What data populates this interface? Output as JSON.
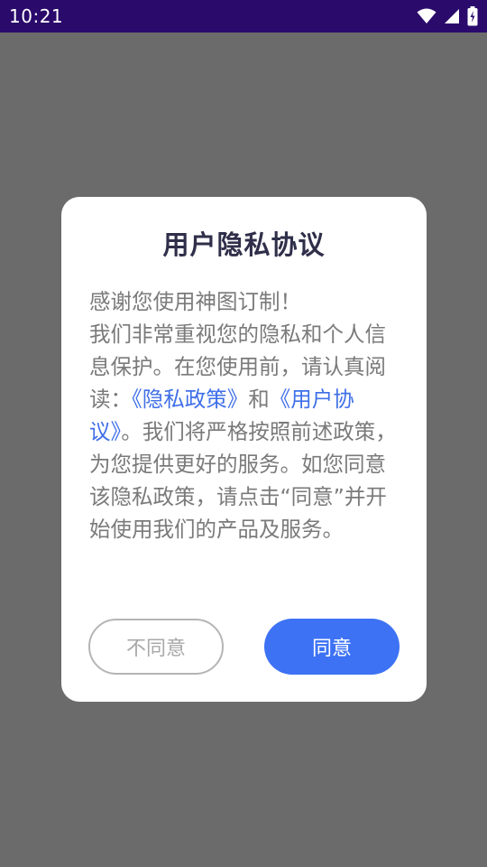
{
  "status_bar": {
    "time": "10:21",
    "icons": [
      "wifi-icon",
      "cellular-signal-icon",
      "battery-charging-icon"
    ]
  },
  "dialog": {
    "title": "用户隐私协议",
    "greeting": "感谢您使用神图订制！",
    "body_part1": "我们非常重视您的隐私和个人信息保护。在您使用前，请认真阅读：",
    "privacy_link": "《隐私政策》",
    "connector": "和",
    "user_agreement_link": "《用户协议》",
    "body_part2": "。我们将严格按照前述政策，为您提供更好的服务。如您同意该隐私政策，请点击“同意”并开始使用我们的产品及服务。",
    "disagree_label": "不同意",
    "agree_label": "同意"
  },
  "colors": {
    "overlay": "#6b6b6b",
    "status_bar": "#2a0a6b",
    "link": "#3f6fe8",
    "primary_button": "#3d72f4"
  }
}
